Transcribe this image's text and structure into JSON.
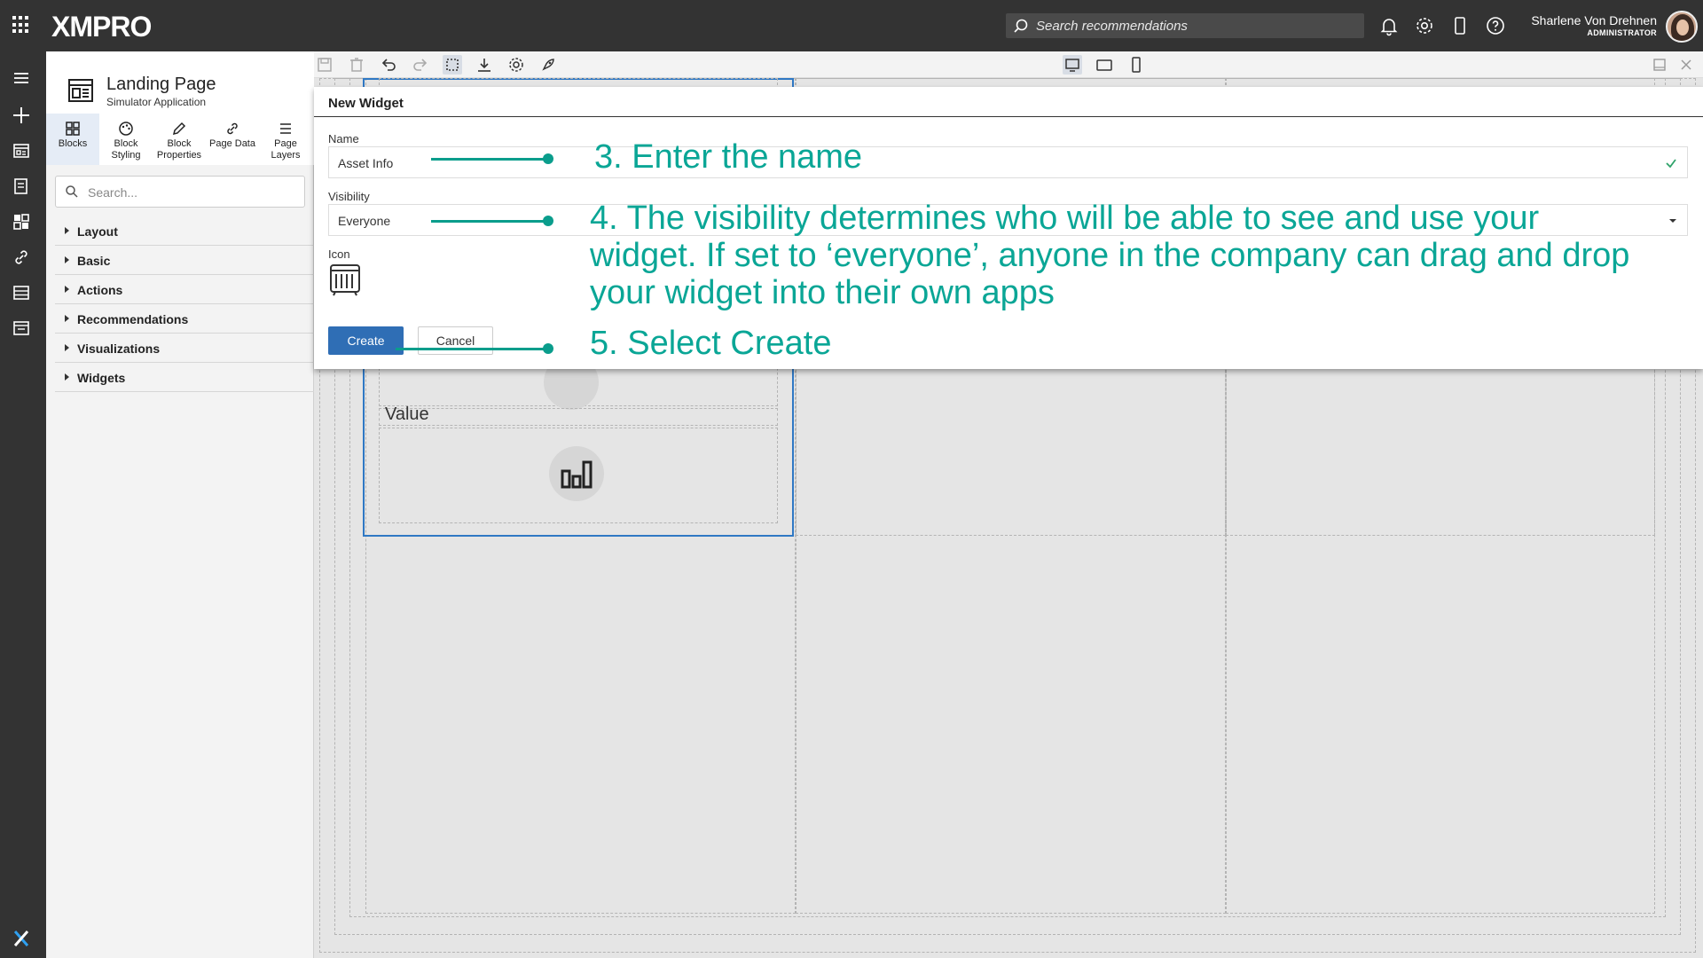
{
  "app": {
    "logo_text": "XMPRO"
  },
  "topbar": {
    "search_placeholder": "Search recommendations",
    "user_name": "Sharlene Von Drehnen",
    "user_role": "ADMINISTRATOR",
    "icons": [
      "bell-icon",
      "gear-icon",
      "mobile-icon",
      "help-icon"
    ]
  },
  "rail": {
    "icons": [
      "menu-icon",
      "add-icon",
      "apps-icon",
      "book-icon",
      "dashboard-icon",
      "link-icon",
      "table-icon",
      "page-icon"
    ]
  },
  "panel": {
    "page_title": "Landing Page",
    "page_subtitle": "Simulator Application",
    "tabs": [
      {
        "label": "Blocks",
        "icon": "grid-icon"
      },
      {
        "label": "Block Styling",
        "icon": "palette-icon"
      },
      {
        "label": "Block Properties",
        "icon": "pencil-icon"
      },
      {
        "label": "Page Data",
        "icon": "link-icon"
      },
      {
        "label": "Page Layers",
        "icon": "layers-icon"
      }
    ],
    "search_placeholder": "Search...",
    "categories": [
      "Layout",
      "Basic",
      "Actions",
      "Recommendations",
      "Visualizations",
      "Widgets"
    ]
  },
  "canvas": {
    "value_label": "Value"
  },
  "modal": {
    "title": "New Widget",
    "name_label": "Name",
    "name_value": "Asset Info",
    "visibility_label": "Visibility",
    "visibility_value": "Everyone",
    "icon_label": "Icon",
    "create_label": "Create",
    "cancel_label": "Cancel"
  },
  "annotations": {
    "step3": "3. Enter the name",
    "step4_line1": "4. The visibility determines who will be able to see and use your",
    "step4_line2": "widget. If set to ‘everyone’, anyone in the company can drag and drop",
    "step4_line3": "your widget into their own apps",
    "step5": "5. Select Create"
  },
  "colors": {
    "accent": "#0aa696",
    "primary_button": "#2f6eb5",
    "topbar": "#333333",
    "selection": "#2f78c4"
  }
}
